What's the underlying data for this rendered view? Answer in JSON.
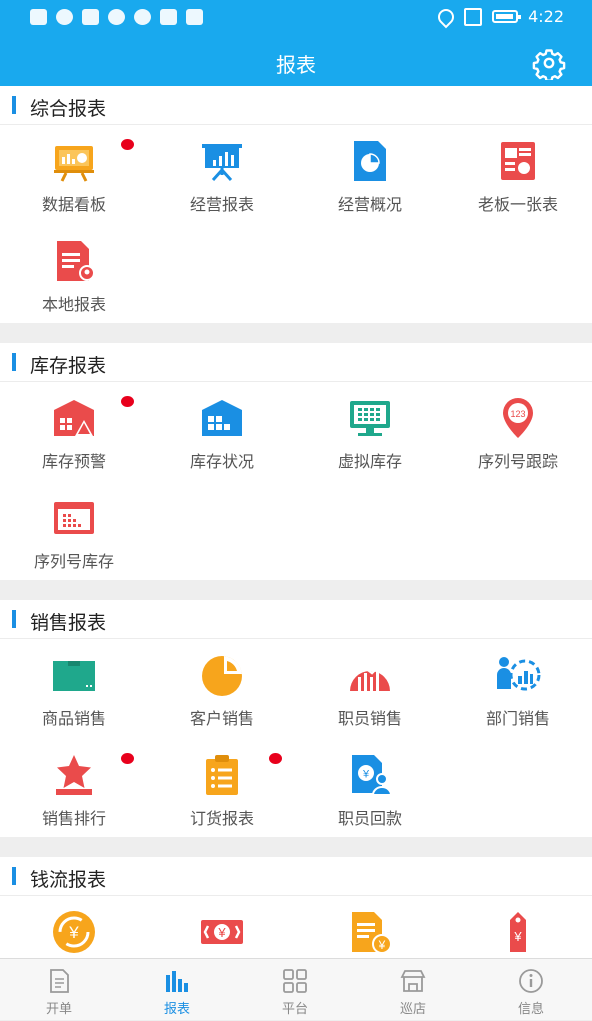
{
  "status_bar": {
    "time": "4:22"
  },
  "header": {
    "title": "报表"
  },
  "sections": [
    {
      "title": "综合报表",
      "items": [
        {
          "label": "数据看板",
          "icon": "dashboard-board-icon",
          "color": "#f7a51c",
          "badge": true
        },
        {
          "label": "经营报表",
          "icon": "presentation-chart-icon",
          "color": "#1a8fe3",
          "badge": false
        },
        {
          "label": "经营概况",
          "icon": "pie-document-icon",
          "color": "#1a8fe3",
          "badge": false
        },
        {
          "label": "老板一张表",
          "icon": "report-sheet-icon",
          "color": "#ea4b4b",
          "badge": false
        },
        {
          "label": "本地报表",
          "icon": "location-document-icon",
          "color": "#ea4b4b",
          "badge": false
        }
      ]
    },
    {
      "title": "库存报表",
      "items": [
        {
          "label": "库存预警",
          "icon": "warehouse-warning-icon",
          "color": "#ea4b4b",
          "badge": true
        },
        {
          "label": "库存状况",
          "icon": "warehouse-boxes-icon",
          "color": "#1a8fe3",
          "badge": false
        },
        {
          "label": "虚拟库存",
          "icon": "monitor-grid-icon",
          "color": "#1fa88c",
          "badge": false
        },
        {
          "label": "序列号跟踪",
          "icon": "serial-pin-icon",
          "color": "#ea4b4b",
          "badge": false
        },
        {
          "label": "序列号库存",
          "icon": "serial-window-icon",
          "color": "#ea4b4b",
          "badge": false
        }
      ]
    },
    {
      "title": "销售报表",
      "items": [
        {
          "label": "商品销售",
          "icon": "product-box-icon",
          "color": "#1fa88c",
          "badge": false
        },
        {
          "label": "客户销售",
          "icon": "customer-pie-icon",
          "color": "#f7a51c",
          "badge": false
        },
        {
          "label": "职员销售",
          "icon": "staff-trend-icon",
          "color": "#ea4b4b",
          "badge": false
        },
        {
          "label": "部门销售",
          "icon": "department-chart-icon",
          "color": "#1a8fe3",
          "badge": false
        },
        {
          "label": "销售排行",
          "icon": "ranking-star-icon",
          "color": "#ea4b4b",
          "badge": true
        },
        {
          "label": "订货报表",
          "icon": "order-clipboard-icon",
          "color": "#f7a51c",
          "badge": true
        },
        {
          "label": "职员回款",
          "icon": "staff-payment-icon",
          "color": "#1a8fe3",
          "badge": false
        }
      ]
    },
    {
      "title": "钱流报表",
      "items": [
        {
          "label": "",
          "icon": "yuan-cycle-icon",
          "color": "#f7a51c",
          "badge": false
        },
        {
          "label": "",
          "icon": "yuan-banknote-icon",
          "color": "#ea4b4b",
          "badge": false
        },
        {
          "label": "",
          "icon": "yuan-document-icon",
          "color": "#f7a51c",
          "badge": false
        },
        {
          "label": "",
          "icon": "yuan-tag-icon",
          "color": "#ea4b4b",
          "badge": false
        }
      ]
    }
  ],
  "tabbar": [
    {
      "label": "开单",
      "icon": "document-icon",
      "active": false
    },
    {
      "label": "报表",
      "icon": "bar-chart-icon",
      "active": true
    },
    {
      "label": "平台",
      "icon": "grid-icon",
      "active": false
    },
    {
      "label": "巡店",
      "icon": "store-icon",
      "active": false
    },
    {
      "label": "信息",
      "icon": "info-icon",
      "active": false
    }
  ],
  "colors": {
    "primary": "#19a9ee",
    "accent": "#1a8fe3",
    "badge": "#e8001c",
    "orange": "#f7a51c",
    "red": "#ea4b4b",
    "green": "#1fa88c"
  }
}
